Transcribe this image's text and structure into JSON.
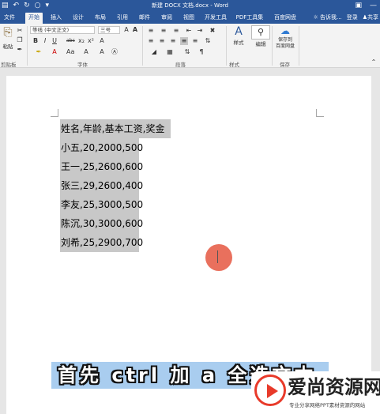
{
  "window": {
    "title": "新建 DOCX 文档.docx - Word",
    "qat_icons": [
      "save-icon",
      "undo-icon",
      "redo-icon",
      "touch-mode-icon"
    ]
  },
  "tabs": [
    {
      "label": "文件",
      "active": false
    },
    {
      "label": "开始",
      "active": true
    },
    {
      "label": "插入",
      "active": false
    },
    {
      "label": "设计",
      "active": false
    },
    {
      "label": "布局",
      "active": false
    },
    {
      "label": "引用",
      "active": false
    },
    {
      "label": "邮件",
      "active": false
    },
    {
      "label": "审阅",
      "active": false
    },
    {
      "label": "视图",
      "active": false
    },
    {
      "label": "开发工具",
      "active": false
    },
    {
      "label": "PDF工具集",
      "active": false
    },
    {
      "label": "百度网盘",
      "active": false
    }
  ],
  "tab_right": {
    "tell_me": "告诉我...",
    "login": "登录",
    "share": "共享"
  },
  "ribbon": {
    "paste_label": "粘贴",
    "clipboard_label": "剪贴板",
    "font_name": "等线 (中文正文)",
    "font_size": "三号",
    "font_group_label": "字体",
    "paragraph_label": "段落",
    "styles_button": "样式",
    "styles_label": "样式",
    "edit_button": "编辑",
    "baidu_save_line1": "保存到",
    "baidu_save_line2": "百度网盘",
    "save_group_label": "保存"
  },
  "document": {
    "lines": [
      "姓名,年龄,基本工资,奖金",
      "小五,20,2000,500",
      "王一,25,2600,600",
      "张三,29,2600,400",
      "李友,25,3000,500",
      "陈沉,30,3000,600",
      "刘希,25,2900,700"
    ]
  },
  "overlay": {
    "subtitle": "首先 ctrl 加 a 全选文本"
  },
  "watermark": {
    "name": "爱尚资源网",
    "tagline": "专业分享网络PPT素材资源的网站"
  },
  "colors": {
    "title_bar": "#2b579a",
    "selection": "#c8c8c8",
    "cursor_marker": "#e9705d",
    "subtitle_bg": "#a9cdef"
  }
}
